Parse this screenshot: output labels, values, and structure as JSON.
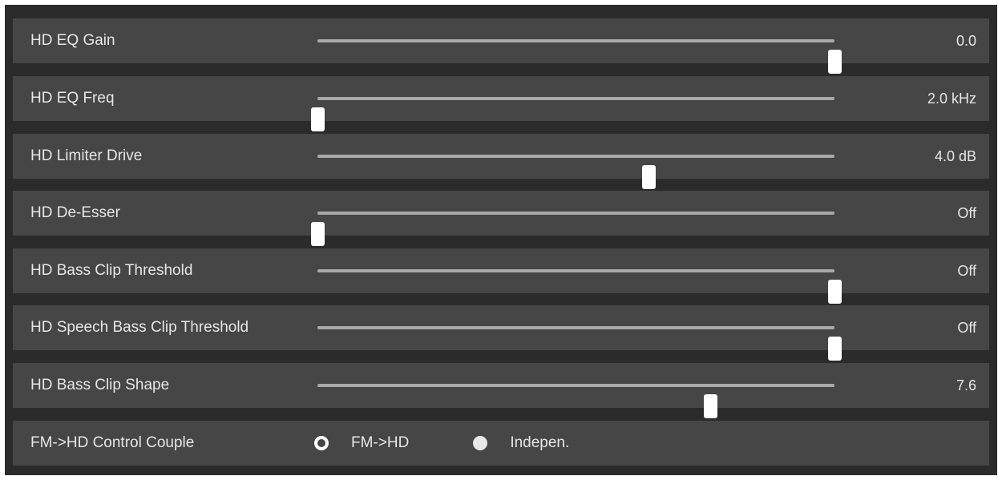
{
  "sliders": [
    {
      "label": "HD EQ Gain",
      "value": "0.0",
      "level": 1.0
    },
    {
      "label": "HD EQ Freq",
      "value": "2.0 kHz",
      "level": 0.0
    },
    {
      "label": "HD Limiter Drive",
      "value": "4.0 dB",
      "level": 0.64
    },
    {
      "label": "HD De-Esser",
      "value": "Off",
      "level": 0.0
    },
    {
      "label": "HD Bass Clip Threshold",
      "value": "Off",
      "level": 1.0
    },
    {
      "label": "HD Speech Bass Clip Threshold",
      "value": "Off",
      "level": 1.0
    },
    {
      "label": "HD Bass Clip Shape",
      "value": "7.6",
      "level": 0.76
    }
  ],
  "couple": {
    "label": "FM->HD Control Couple",
    "options": [
      {
        "label": "FM->HD",
        "selected": true
      },
      {
        "label": "Indepen.",
        "selected": false
      }
    ]
  },
  "colors": {
    "panel": "#2b2b2b",
    "row": "#464646",
    "track": "#a9a9a9",
    "thumb": "#ffffff",
    "text": "#e6e6e6"
  }
}
